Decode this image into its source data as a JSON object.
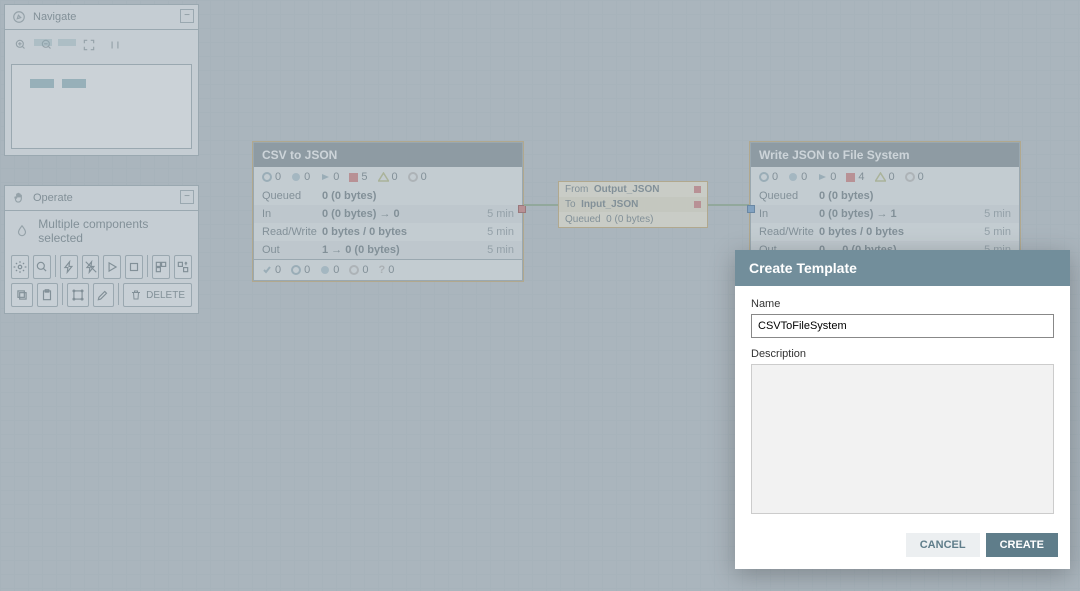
{
  "navigate": {
    "title": "Navigate"
  },
  "operate": {
    "title": "Operate",
    "selection_text": "Multiple components selected",
    "delete_label": "DELETE"
  },
  "processors": [
    {
      "title": "CSV to JSON",
      "status": {
        "stopped": "0",
        "invalid": "0",
        "running": "0",
        "red": "5",
        "warning": "0",
        "disabled": "0"
      },
      "rows": [
        {
          "label": "Queued",
          "val": "0 (0 bytes)",
          "time": ""
        },
        {
          "label": "In",
          "val": "0 (0 bytes) → 0",
          "time": "5 min"
        },
        {
          "label": "Read/Write",
          "val": "0 bytes / 0 bytes",
          "time": "5 min"
        },
        {
          "label": "Out",
          "val": "1 → 0 (0 bytes)",
          "time": "5 min"
        }
      ],
      "footer": {
        "a": "0",
        "b": "0",
        "c": "0",
        "d": "0",
        "e": "0"
      }
    },
    {
      "title": "Write JSON to File System",
      "status": {
        "stopped": "0",
        "invalid": "0",
        "running": "0",
        "red": "4",
        "warning": "0",
        "disabled": "0"
      },
      "rows": [
        {
          "label": "Queued",
          "val": "0 (0 bytes)",
          "time": ""
        },
        {
          "label": "In",
          "val": "0 (0 bytes) → 1",
          "time": "5 min"
        },
        {
          "label": "Read/Write",
          "val": "0 bytes / 0 bytes",
          "time": "5 min"
        },
        {
          "label": "Out",
          "val": "0 → 0 (0 bytes)",
          "time": "5 min"
        }
      ]
    }
  ],
  "connection": {
    "from_label": "From",
    "from_val": "Output_JSON",
    "to_label": "To",
    "to_val": "Input_JSON",
    "queued_label": "Queued",
    "queued_val": "0 (0 bytes)"
  },
  "dialog": {
    "title": "Create Template",
    "name_label": "Name",
    "name_value": "CSVToFileSystem",
    "desc_label": "Description",
    "desc_value": "",
    "cancel": "CANCEL",
    "create": "CREATE"
  }
}
